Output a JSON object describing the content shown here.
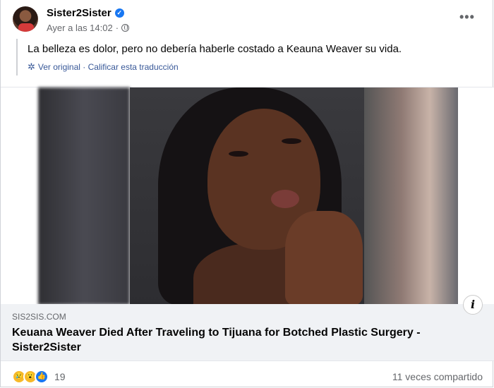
{
  "post": {
    "page_name": "Sister2Sister",
    "timestamp": "Ayer a las 14:02",
    "separator": "·",
    "text": "La belleza es dolor, pero no debería haberle costado a Keauna Weaver su vida.",
    "translation_links": "Ver original · Calificar esta traducción",
    "more_label": "•••"
  },
  "link_preview": {
    "domain": "SIS2SIS.COM",
    "headline": "Keuana Weaver Died After Traveling to Tijuana for Botched Plastic Surgery - Sister2Sister",
    "info_label": "i"
  },
  "footer": {
    "reaction_count": "19",
    "shares": "11 veces compartido",
    "reactions": [
      "sad",
      "wow",
      "like"
    ]
  },
  "colors": {
    "link": "#385898",
    "verified": "#1877f2",
    "secondary_text": "#65676b",
    "preview_bg": "#f0f2f5"
  }
}
